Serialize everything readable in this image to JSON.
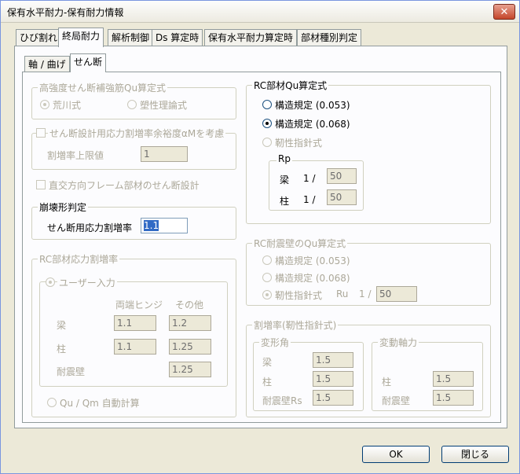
{
  "window": {
    "title": "保有水平耐力-保有耐力情報",
    "close_glyph": "✕"
  },
  "tabs": [
    {
      "label": "ひび割れ"
    },
    {
      "label": "終局耐力"
    },
    {
      "label": "解析制御"
    },
    {
      "label": "Ds 算定時"
    },
    {
      "label": "保有水平耐力算定時"
    },
    {
      "label": "部材種別判定"
    }
  ],
  "subtabs": [
    {
      "label": "軸 / 曲げ"
    },
    {
      "label": "せん断"
    }
  ],
  "high_strength": {
    "legend": "高強度せん断補強筋Qu算定式",
    "opt1": "荒川式",
    "opt2": "塑性理論式"
  },
  "design_stress": {
    "legend": "せん断設計用応力割増率余裕度αMを考慮",
    "limit_label": "割増率上限値",
    "limit_value": "1"
  },
  "orthogonal": {
    "label": "直交方向フレーム部材のせん断設計"
  },
  "collapse": {
    "legend": "崩壊形判定",
    "label": "せん断用応力割増率",
    "value": "1.1"
  },
  "rc_stress": {
    "legend": "RC部材応力割増率",
    "user_legend": "ユーザー入力",
    "col1": "両端ヒンジ",
    "col2": "その他",
    "beam": "梁",
    "column": "柱",
    "wall": "耐震壁",
    "beam_v1": "1.1",
    "beam_v2": "1.2",
    "col_v1": "1.1",
    "col_v2": "1.25",
    "wall_v2": "1.25",
    "auto": "Qu / Qm 自動計算"
  },
  "rc_qu": {
    "legend": "RC部材Qu算定式",
    "opt1": "構造規定 (0.053)",
    "opt2": "構造規定 (0.068)",
    "opt3": "靭性指針式",
    "rp_legend": "Rp",
    "beam": "梁",
    "column": "柱",
    "one_slash": "1 /",
    "beam_value": "50",
    "column_value": "50"
  },
  "wall_qu": {
    "legend": "RC耐震壁のQu算定式",
    "opt1": "構造規定 (0.053)",
    "opt2": "構造規定 (0.068)",
    "opt3": "靭性指針式",
    "ru": "Ru",
    "one_slash": "1 /",
    "ru_value": "50"
  },
  "rate": {
    "legend": "割増率(靭性指針式)",
    "deform_legend": "変形角",
    "beam": "梁",
    "column": "柱",
    "wall": "耐震壁Rs",
    "beam_value": "1.5",
    "column_value": "1.5",
    "wall_value": "1.5",
    "axial_legend": "変動軸力",
    "axial_column": "柱",
    "axial_wall": "耐震壁",
    "axial_column_value": "1.5",
    "axial_wall_value": "1.5"
  },
  "buttons": {
    "ok": "OK",
    "close": "閉じる"
  }
}
